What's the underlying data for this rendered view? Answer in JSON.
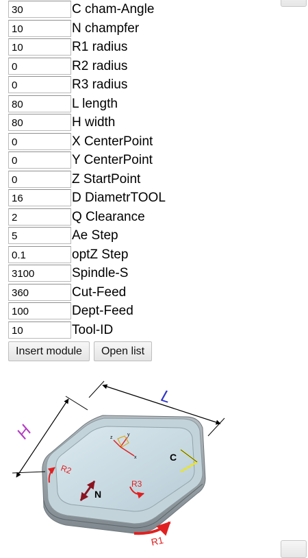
{
  "params": [
    {
      "value": "30",
      "label": "C cham-Angle"
    },
    {
      "value": "10",
      "label": "N champfer"
    },
    {
      "value": "10",
      "label": "R1 radius"
    },
    {
      "value": "0",
      "label": "R2 radius"
    },
    {
      "value": "0",
      "label": "R3 radius"
    },
    {
      "value": "80",
      "label": "L length"
    },
    {
      "value": "80",
      "label": "H width"
    },
    {
      "value": "0",
      "label": "X CenterPoint"
    },
    {
      "value": "0",
      "label": "Y CenterPoint"
    },
    {
      "value": "0",
      "label": "Z StartPoint"
    },
    {
      "value": "16",
      "label": "D DiametrTOOL"
    },
    {
      "value": "2",
      "label": "Q Clearance"
    },
    {
      "value": "5",
      "label": "Ae Step"
    },
    {
      "value": "0.1",
      "label": "optZ Step"
    },
    {
      "value": "3100",
      "label": "Spindle-S"
    },
    {
      "value": "360",
      "label": "Cut-Feed"
    },
    {
      "value": "100",
      "label": "Dept-Feed"
    },
    {
      "value": "10",
      "label": "Tool-ID"
    }
  ],
  "buttons": {
    "insert": "Insert module",
    "open": "Open list"
  },
  "diagram": {
    "labels": {
      "L": "L",
      "H": "H",
      "C": "C",
      "N": "N",
      "R1": "R1",
      "R2": "R2",
      "R3": "R3",
      "axis_x": "x",
      "axis_y": "y",
      "axis_z": "z"
    },
    "colors": {
      "L": "#2f35c8",
      "H": "#b43cc4",
      "R": "#e02020",
      "N": "#8a1420",
      "C": "#000000",
      "chamfer_mark": "#f4e800",
      "body_top": "#c9dde6",
      "body_side": "#9ea8ae"
    }
  }
}
